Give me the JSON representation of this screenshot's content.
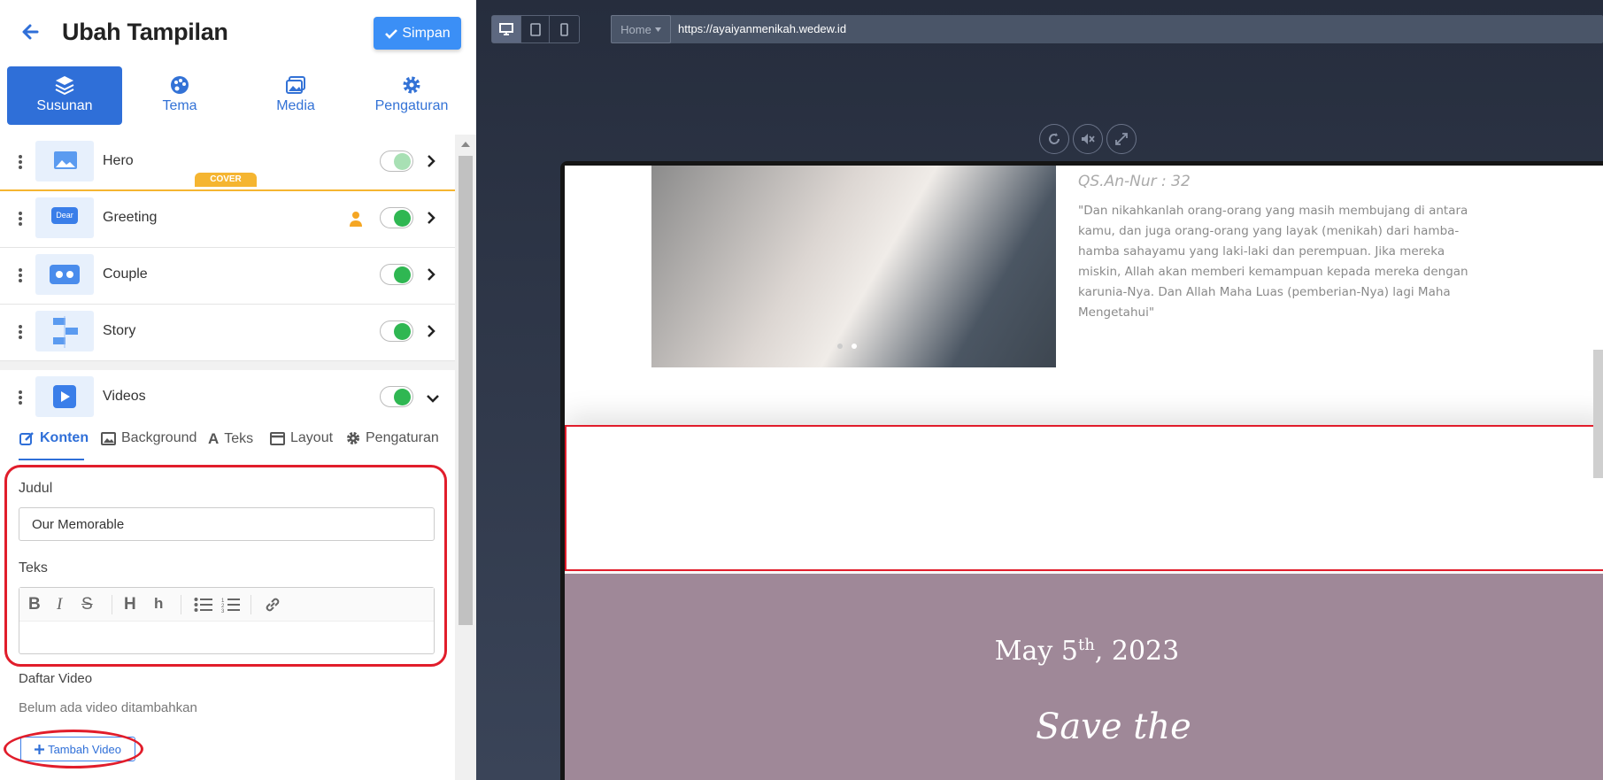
{
  "header": {
    "title": "Ubah Tampilan",
    "save_label": "Simpan"
  },
  "tabs": [
    {
      "label": "Susunan",
      "icon": "layers-icon"
    },
    {
      "label": "Tema",
      "icon": "palette-icon"
    },
    {
      "label": "Media",
      "icon": "images-icon"
    },
    {
      "label": "Pengaturan",
      "icon": "gear-icon"
    }
  ],
  "sections": [
    {
      "label": "Hero",
      "enabled": true,
      "badge": "COVER"
    },
    {
      "label": "Greeting",
      "enabled": true,
      "thumb_text": "Dear"
    },
    {
      "label": "Couple",
      "enabled": true
    },
    {
      "label": "Story",
      "enabled": true
    },
    {
      "label": "Videos",
      "enabled": true
    }
  ],
  "subtabs": [
    "Konten",
    "Background",
    "Teks",
    "Layout",
    "Pengaturan"
  ],
  "form": {
    "judul_label": "Judul",
    "judul_value": "Our Memorable",
    "teks_label": "Teks",
    "toolbar": [
      "B",
      "I",
      "S",
      "H",
      "h"
    ],
    "daftar_label": "Daftar Video",
    "empty_text": "Belum ada video ditambahkan",
    "add_label": "Tambah Video"
  },
  "preview": {
    "page_select": "Home",
    "url": "https://ayaiyanmenikah.wedew.id",
    "verse_ref": "QS.An-Nur : 32",
    "verse": "\"Dan nikahkanlah orang-orang yang masih membujang di antara kamu, dan juga orang-orang yang layak (menikah) dari hamba-hamba sahayamu yang laki-laki dan perempuan. Jika mereka miskin, Allah akan memberi kemampuan kepada mereka dengan karunia-Nya. Dan Allah Maha Luas (pemberian-Nya) lagi Maha Mengetahui\"",
    "date_main": "May 5",
    "date_sup": "th",
    "date_year": ", 2023",
    "script": "Save the"
  },
  "colors": {
    "accent": "#2f6fd8",
    "toggle_on": "#2fb752",
    "highlight": "#e11d2b",
    "badge": "#f5b531"
  }
}
